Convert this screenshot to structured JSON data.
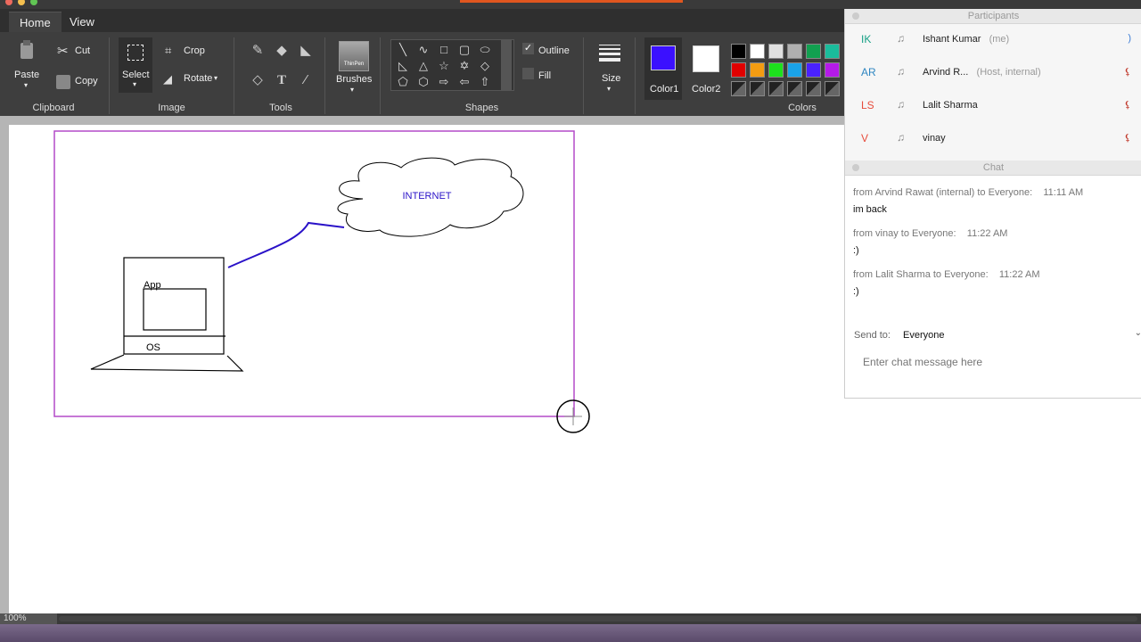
{
  "window": {
    "close_label": "Close"
  },
  "tabs": [
    {
      "label": "Home"
    },
    {
      "label": "View"
    }
  ],
  "ribbon": {
    "clipboard": {
      "paste": "Paste",
      "cut": "Cut",
      "copy": "Copy",
      "group": "Clipboard"
    },
    "image": {
      "select": "Select",
      "crop": "Crop",
      "rotate": "Rotate",
      "group": "Image"
    },
    "tools": {
      "group": "Tools"
    },
    "brushes": {
      "label": "Brushes",
      "icon_text": "ThinPen"
    },
    "shapes": {
      "outline": "Outline",
      "fill": "Fill",
      "group": "Shapes"
    },
    "size": {
      "label": "Size"
    },
    "colors": {
      "color1_label": "Color1",
      "color2_label": "Color2",
      "group": "Colors",
      "color1": "#3b10ff",
      "color2": "#ffffff",
      "palette_row1": [
        "#000000",
        "#ffffff",
        "#e0e0e0",
        "#b0b0b0",
        "#12a050",
        "#1abc9c"
      ],
      "palette_row2": [
        "#e00000",
        "#f39c12",
        "#1de01d",
        "#1aa3e8",
        "#4a22ff",
        "#b41ae8"
      ]
    }
  },
  "drawing": {
    "cloud_text": "INTERNET",
    "app_label": "App",
    "os_label": "OS",
    "frame_color": "#b44ac8",
    "line_color": "#2a12c8"
  },
  "status": {
    "zoom": "100%"
  },
  "participants": {
    "title": "Participants",
    "list": [
      {
        "initials": "IK",
        "name": "Ishant Kumar",
        "meta": "(me)",
        "color": "#16a085"
      },
      {
        "initials": "AR",
        "name": "Arvind R...",
        "meta": "(Host, internal)",
        "color": "#2e86c1"
      },
      {
        "initials": "LS",
        "name": "Lalit Sharma",
        "meta": "",
        "color": "#e74c3c"
      },
      {
        "initials": "V",
        "name": "vinay",
        "meta": "",
        "color": "#e74c3c"
      }
    ]
  },
  "chat": {
    "title": "Chat",
    "messages": [
      {
        "from": "from Arvind Rawat (internal) to Everyone:",
        "time": "11:11  AM",
        "text": "im back"
      },
      {
        "from": "from vinay to Everyone:",
        "time": "11:22  AM",
        "text": " :)"
      },
      {
        "from": "from Lalit Sharma to Everyone:",
        "time": "11:22  AM",
        "text": ":)"
      }
    ],
    "send_to_label": "Send to:",
    "send_to_value": "Everyone",
    "input_placeholder": "Enter chat message here"
  }
}
